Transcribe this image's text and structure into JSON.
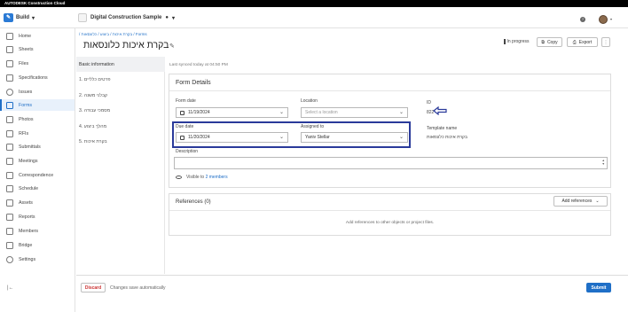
{
  "brand": "AUTODESK Construction Cloud",
  "module": {
    "label": "Build",
    "icon": "build-icon"
  },
  "project": {
    "name": "Digital Construction Sample"
  },
  "sidebar": {
    "items": [
      {
        "label": "Home",
        "icon": "home-icon"
      },
      {
        "label": "Sheets",
        "icon": "sheets-icon"
      },
      {
        "label": "Files",
        "icon": "files-icon"
      },
      {
        "label": "Specifications",
        "icon": "specifications-icon"
      },
      {
        "label": "Issues",
        "icon": "issues-icon"
      },
      {
        "label": "Forms",
        "icon": "forms-icon",
        "active": true
      },
      {
        "label": "Photos",
        "icon": "photos-icon"
      },
      {
        "label": "RFIs",
        "icon": "rfis-icon"
      },
      {
        "label": "Submittals",
        "icon": "submittals-icon"
      },
      {
        "label": "Meetings",
        "icon": "meetings-icon"
      },
      {
        "label": "Correspondence",
        "icon": "correspondence-icon"
      },
      {
        "label": "Schedule",
        "icon": "schedule-icon"
      },
      {
        "label": "Assets",
        "icon": "assets-icon"
      },
      {
        "label": "Reports",
        "icon": "reports-icon"
      },
      {
        "label": "Members",
        "icon": "members-icon"
      },
      {
        "label": "Bridge",
        "icon": "bridge-icon"
      },
      {
        "label": "Settings",
        "icon": "settings-icon"
      }
    ],
    "collapse_label": "|←"
  },
  "header": {
    "breadcrumb": "Forms / בקרת איכות / ביצוע / כלונסאות /",
    "title": "בקרת איכות כלונסאות",
    "status": "In progress",
    "copy_label": "Copy",
    "export_label": "Export",
    "more_label": "⋮"
  },
  "steps": [
    {
      "label": "Basic information",
      "active": true
    },
    {
      "label": "1. פרטים כלליים"
    },
    {
      "label": "2. קבלני משנה"
    },
    {
      "label": "3. מסמכי עבודה"
    },
    {
      "label": "4. מהלך ביצוע"
    },
    {
      "label": "5. בקרת איכות"
    }
  ],
  "sync_text": "Last synced today at 04:50 PM",
  "form_details": {
    "title": "Form Details",
    "form_date_label": "Form date",
    "form_date_value": "11/19/2024",
    "location_label": "Location",
    "location_placeholder": "Select a location",
    "id_label": "ID",
    "id_value": "822",
    "due_date_label": "Due date",
    "due_date_value": "11/20/2024",
    "assigned_label": "Assigned to",
    "assigned_value": "Yaniv Stellar",
    "template_label": "Template name",
    "template_value": "בקרת איכות כלונסאות",
    "description_label": "Description",
    "visible_prefix": "Visible to",
    "visible_link": "2 members"
  },
  "references": {
    "title": "References (0)",
    "add_label": "Add references",
    "empty_text": "Add references to other objects or project files."
  },
  "footer": {
    "discard_label": "Discard",
    "autosave_text": "Changes save automatically",
    "submit_label": "Submit"
  },
  "colors": {
    "accent": "#1f6fc7",
    "highlight_box": "#2a3a9a",
    "topbar": "#000000"
  }
}
